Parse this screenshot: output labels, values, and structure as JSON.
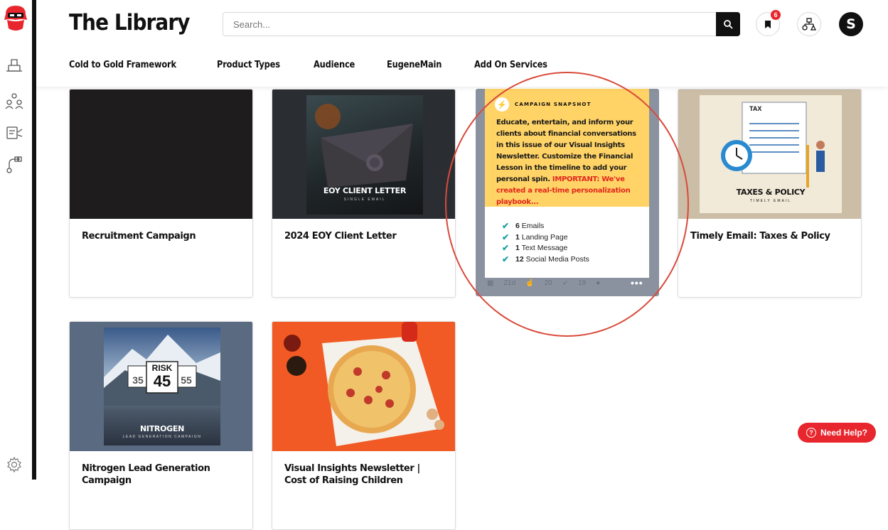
{
  "app": {
    "title": "The Library"
  },
  "search": {
    "placeholder": "Search..."
  },
  "header": {
    "bookmark_count": "6",
    "avatar_initial": "S"
  },
  "menu": [
    "Cold to Gold Framework",
    "Product Types",
    "Audience",
    "EugeneMain",
    "Add On Services"
  ],
  "cards": [
    {
      "title": "Recruitment Campaign"
    },
    {
      "title": "2024 EOY Client Letter",
      "thumb_title": "EOY CLIENT LETTER",
      "thumb_sub": "SINGLE EMAIL"
    },
    {
      "title": "Timely Email: Taxes & Policy",
      "thumb_title": "TAXES & POLICY",
      "thumb_sub": "TIMELY EMAIL",
      "thumb_tag": "TAX"
    },
    {
      "title": "Nitrogen Lead Generation Campaign",
      "thumb_title": "NITROGEN",
      "thumb_sub": "LEAD GENERATION CAMPAIGN",
      "risk_label": "RISK",
      "risk_value": "45",
      "risk_left": "35",
      "risk_right": "55"
    },
    {
      "title": "Visual Insights Newsletter | Cost of Raising Children"
    }
  ],
  "snapshot": {
    "label": "CAMPAIGN SNAPSHOT",
    "text": "Educate, entertain, and inform your clients about financial conversations in this issue of our Visual Insights Newsletter. Customize the Financial Lesson in the timeline to add your personal spin.",
    "important": "IMPORTANT: We've created a real-time personalization playbook...",
    "items": [
      {
        "count": "6",
        "label": "Emails"
      },
      {
        "count": "1",
        "label": "Landing Page"
      },
      {
        "count": "1",
        "label": "Text Message"
      },
      {
        "count": "12",
        "label": "Social Media Posts"
      }
    ],
    "stats": {
      "days": "21d",
      "likes": "20",
      "launches": "19"
    },
    "more": "•••"
  },
  "help": {
    "label": "Need Help?"
  },
  "colors": {
    "accent": "#e8262d",
    "snapshot_bg": "#ffd366",
    "check": "#1aa3a3"
  }
}
